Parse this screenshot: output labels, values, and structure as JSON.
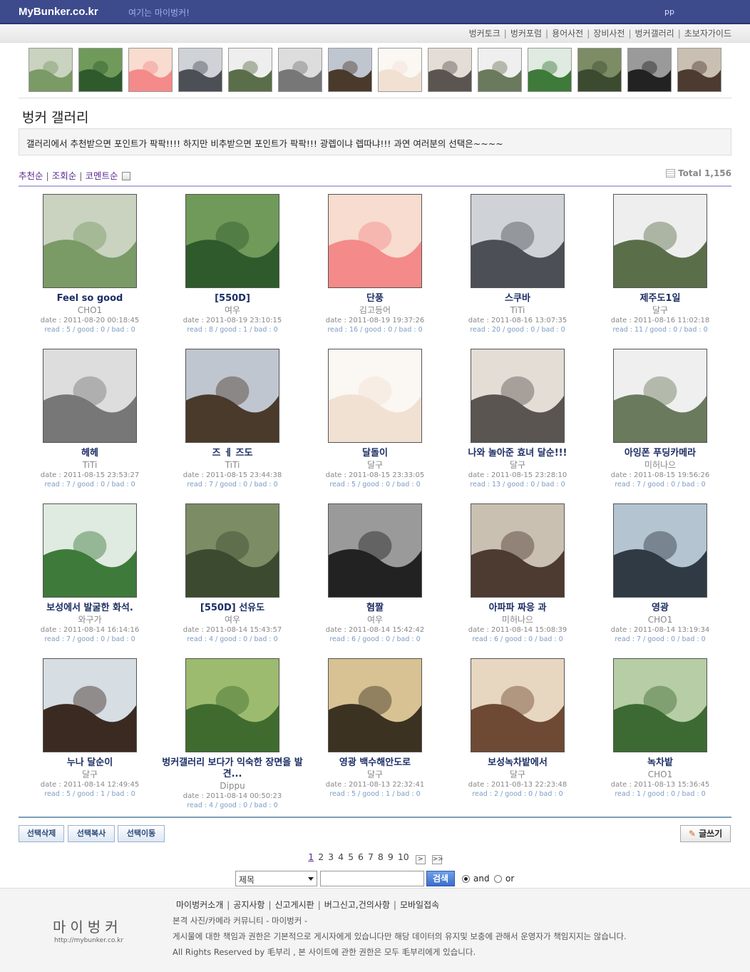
{
  "header": {
    "logo": "MyBunker.co.kr",
    "slogan": "여기는 마이벙커!",
    "user": "pp"
  },
  "submenu": [
    "벙커토크",
    "벙커포럼",
    "용어사전",
    "장비사전",
    "벙커갤러리",
    "초보자가이드"
  ],
  "gallery": {
    "title": "벙커 갤러리",
    "notice": "갤러리에서 추천받으면 포인트가 팍팍!!!! 하지만 비추받으면 포인트가 팍팍!!! 광렙이냐 렙따냐!!! 과연 여러분의 선택은~~~~",
    "sort": [
      "추천순",
      "조회순",
      "코멘트순"
    ],
    "total": "Total 1,156"
  },
  "posts": [
    {
      "title": "Feel so good",
      "author": "CHO1",
      "date": "date : 2011-08-20 00:18:45",
      "stats": "read : 5 / good : 0 / bad : 0",
      "c1": "#7a9a66",
      "c2": "#c9d3c0"
    },
    {
      "title": "[550D]",
      "author": "여우",
      "date": "date : 2011-08-19 23:10:15",
      "stats": "read : 8 / good : 1 / bad : 0",
      "c1": "#2e5a2c",
      "c2": "#6f9a5a"
    },
    {
      "title": "단풍",
      "author": "김고등어",
      "date": "date : 2011-08-19 19:37:26",
      "stats": "read : 16 / good : 0 / bad : 0",
      "c1": "#f48a8a",
      "c2": "#f7dccf"
    },
    {
      "title": "스쿠바",
      "author": "TiTi",
      "date": "date : 2011-08-16 13:07:35",
      "stats": "read : 20 / good : 0 / bad : 0",
      "c1": "#4c4f55",
      "c2": "#cfd2d6"
    },
    {
      "title": "제주도1일",
      "author": "달구",
      "date": "date : 2011-08-16 11:02:18",
      "stats": "read : 11 / good : 0 / bad : 0",
      "c1": "#5b6e4a",
      "c2": "#eeeeee"
    },
    {
      "title": "헤헤",
      "author": "TiTi",
      "date": "date : 2011-08-15 23:53:27",
      "stats": "read : 7 / good : 0 / bad : 0",
      "c1": "#777777",
      "c2": "#dddddd"
    },
    {
      "title": "즈 ㅔ 즈도",
      "author": "TiTi",
      "date": "date : 2011-08-15 23:44:38",
      "stats": "read : 7 / good : 0 / bad : 0",
      "c1": "#4a3a2c",
      "c2": "#bfc6cf"
    },
    {
      "title": "달돌이",
      "author": "달구",
      "date": "date : 2011-08-15 23:33:05",
      "stats": "read : 5 / good : 0 / bad : 0",
      "c1": "#f1e1d3",
      "c2": "#fbf7f2"
    },
    {
      "title": "나와 놀아준 효녀 달순!!!",
      "author": "달구",
      "date": "date : 2011-08-15 23:28:10",
      "stats": "read : 13 / good : 0 / bad : 0",
      "c1": "#5b5552",
      "c2": "#e4ddd6"
    },
    {
      "title": "아잉폰 푸딩카메라",
      "author": "미허나으",
      "date": "date : 2011-08-15 19:56:26",
      "stats": "read : 7 / good : 0 / bad : 0",
      "c1": "#6a7a5c",
      "c2": "#efefef"
    },
    {
      "title": "보성에서 발굴한 화석.",
      "author": "와구가",
      "date": "date : 2011-08-14 16:14:16",
      "stats": "read : 7 / good : 0 / bad : 0",
      "c1": "#3e7a3a",
      "c2": "#dfeae0"
    },
    {
      "title": "[550D] 선유도",
      "author": "여우",
      "date": "date : 2011-08-14 15:43:57",
      "stats": "read : 4 / good : 0 / bad : 0",
      "c1": "#3c4a2f",
      "c2": "#7c8c64"
    },
    {
      "title": "혐짤",
      "author": "여우",
      "date": "date : 2011-08-14 15:42:42",
      "stats": "read : 6 / good : 0 / bad : 0",
      "c1": "#222222",
      "c2": "#9a9a9a"
    },
    {
      "title": "아파파 짜응 과",
      "author": "미허나으",
      "date": "date : 2011-08-14 15:08:39",
      "stats": "read : 6 / good : 0 / bad : 0",
      "c1": "#4d3a30",
      "c2": "#c9c0b2"
    },
    {
      "title": "영광",
      "author": "CHO1",
      "date": "date : 2011-08-14 13:19:34",
      "stats": "read : 7 / good : 0 / bad : 0",
      "c1": "#2f3a44",
      "c2": "#b4c4d0"
    },
    {
      "title": "누나 달순이",
      "author": "달구",
      "date": "date : 2011-08-14 12:49:45",
      "stats": "read : 5 / good : 1 / bad : 0",
      "c1": "#3b2a22",
      "c2": "#d6dde3"
    },
    {
      "title": "벙커갤러리 보다가 익숙한 장면을 발견...",
      "author": "Dippu",
      "date": "date : 2011-08-14 00:50:23",
      "stats": "read : 4 / good : 0 / bad : 0",
      "c1": "#3f6c2e",
      "c2": "#9dbb6e"
    },
    {
      "title": "영광 백수해안도로",
      "author": "달구",
      "date": "date : 2011-08-13 22:32:41",
      "stats": "read : 5 / good : 1 / bad : 0",
      "c1": "#3b3222",
      "c2": "#d8c294"
    },
    {
      "title": "보성녹차밭에서",
      "author": "달구",
      "date": "date : 2011-08-13 22:23:48",
      "stats": "read : 2 / good : 0 / bad : 0",
      "c1": "#6e4a34",
      "c2": "#e7d6c0"
    },
    {
      "title": "녹차밭",
      "author": "CHO1",
      "date": "date : 2011-08-13 15:36:45",
      "stats": "read : 1 / good : 0 / bad : 0",
      "c1": "#3d6a32",
      "c2": "#b6cda6"
    }
  ],
  "strip_colors": [
    [
      "#7a9a66",
      "#c9d3c0"
    ],
    [
      "#2e5a2c",
      "#6f9a5a"
    ],
    [
      "#f48a8a",
      "#f7dccf"
    ],
    [
      "#4c4f55",
      "#cfd2d6"
    ],
    [
      "#5b6e4a",
      "#eeeeee"
    ],
    [
      "#777777",
      "#dddddd"
    ],
    [
      "#4a3a2c",
      "#bfc6cf"
    ],
    [
      "#f1e1d3",
      "#fbf7f2"
    ],
    [
      "#5b5552",
      "#e4ddd6"
    ],
    [
      "#6a7a5c",
      "#efefef"
    ],
    [
      "#3e7a3a",
      "#dfeae0"
    ],
    [
      "#3c4a2f",
      "#7c8c64"
    ],
    [
      "#222222",
      "#9a9a9a"
    ],
    [
      "#4d3a30",
      "#c9c0b2"
    ]
  ],
  "actions": {
    "delete": "선택삭제",
    "copy": "선택복사",
    "move": "선택이동",
    "write": "글쓰기"
  },
  "pagination": {
    "pages": [
      "1",
      "2",
      "3",
      "4",
      "5",
      "6",
      "7",
      "8",
      "9",
      "10"
    ],
    "current": "1",
    "next": ">",
    "last": ">>"
  },
  "search": {
    "field": "제목",
    "button": "검색",
    "and": "and",
    "or": "or",
    "selected": "and"
  },
  "footer": {
    "logo": "마이벙커",
    "url": "http://mybunker.co.kr",
    "menu": [
      "마이벙커소개",
      "공지사항",
      "신고게시판",
      "버그신고,건의사항",
      "모바일접속"
    ],
    "line1": "본격 사진/카메라 커뮤니티 - 마이벙커 -",
    "line2": "게시물에 대한 책임과 권한은 기본적으로 게시자에게 있습니다만 해당 데이터의 유지및 보충에 관해서 운영자가 책임지지는 않습니다.",
    "line3": "All Rights Reserved by 毛부리 , 본 사이트에 관한 권한은 모두 毛부리에게 있습니다."
  }
}
